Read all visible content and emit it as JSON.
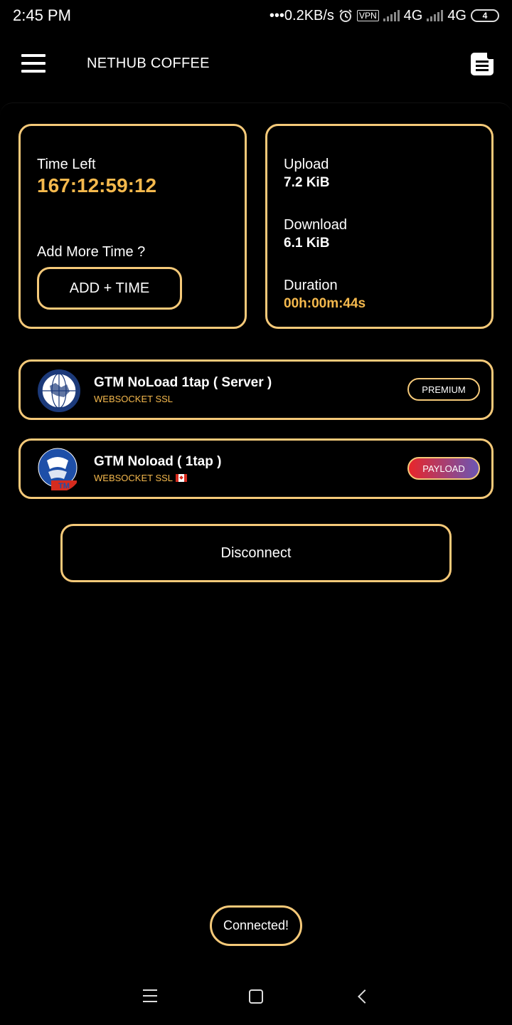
{
  "status_bar": {
    "time": "2:45 PM",
    "speed": "•••0.2KB/s",
    "vpn_label": "VPN",
    "network1": "4G",
    "network2": "4G",
    "battery": "4",
    "icons": [
      "alarm-icon",
      "vpn-icon",
      "signal-icon",
      "battery-icon"
    ]
  },
  "app_bar": {
    "title": "NETHUB COFFEE",
    "icons": [
      "hamburger-menu-icon",
      "document-icon"
    ]
  },
  "time_card": {
    "time_left_label": "Time Left",
    "time_left_value": "167:12:59:12",
    "add_more_label": "Add More Time ?",
    "add_button_label": "ADD + TIME"
  },
  "stats_card": {
    "upload_label": "Upload",
    "upload_value": "7.2 KiB",
    "download_label": "Download",
    "download_value": "6.1 KiB",
    "duration_label": "Duration",
    "duration_value": "00h:00m:44s"
  },
  "servers": [
    {
      "name": "GTM  NoLoad 1tap ( Server )",
      "subtitle": "WEBSOCKET SSL",
      "badge": "PREMIUM",
      "icon": "globe-server-icon"
    },
    {
      "name": "GTM Noload ( 1tap )",
      "subtitle": "WEBSOCKET SSL",
      "badge": "PAYLOAD",
      "icon": "gtm-logo-icon"
    }
  ],
  "disconnect_label": "Disconnect",
  "toast": "Connected!",
  "colors": {
    "accent": "#f5c979",
    "gold_text": "#f5b94d",
    "background": "#000000",
    "payload_start": "#e8262a",
    "payload_end": "#6b56b4"
  },
  "nav_bar": {
    "icons": [
      "recent-apps-icon",
      "home-icon",
      "back-icon"
    ]
  }
}
